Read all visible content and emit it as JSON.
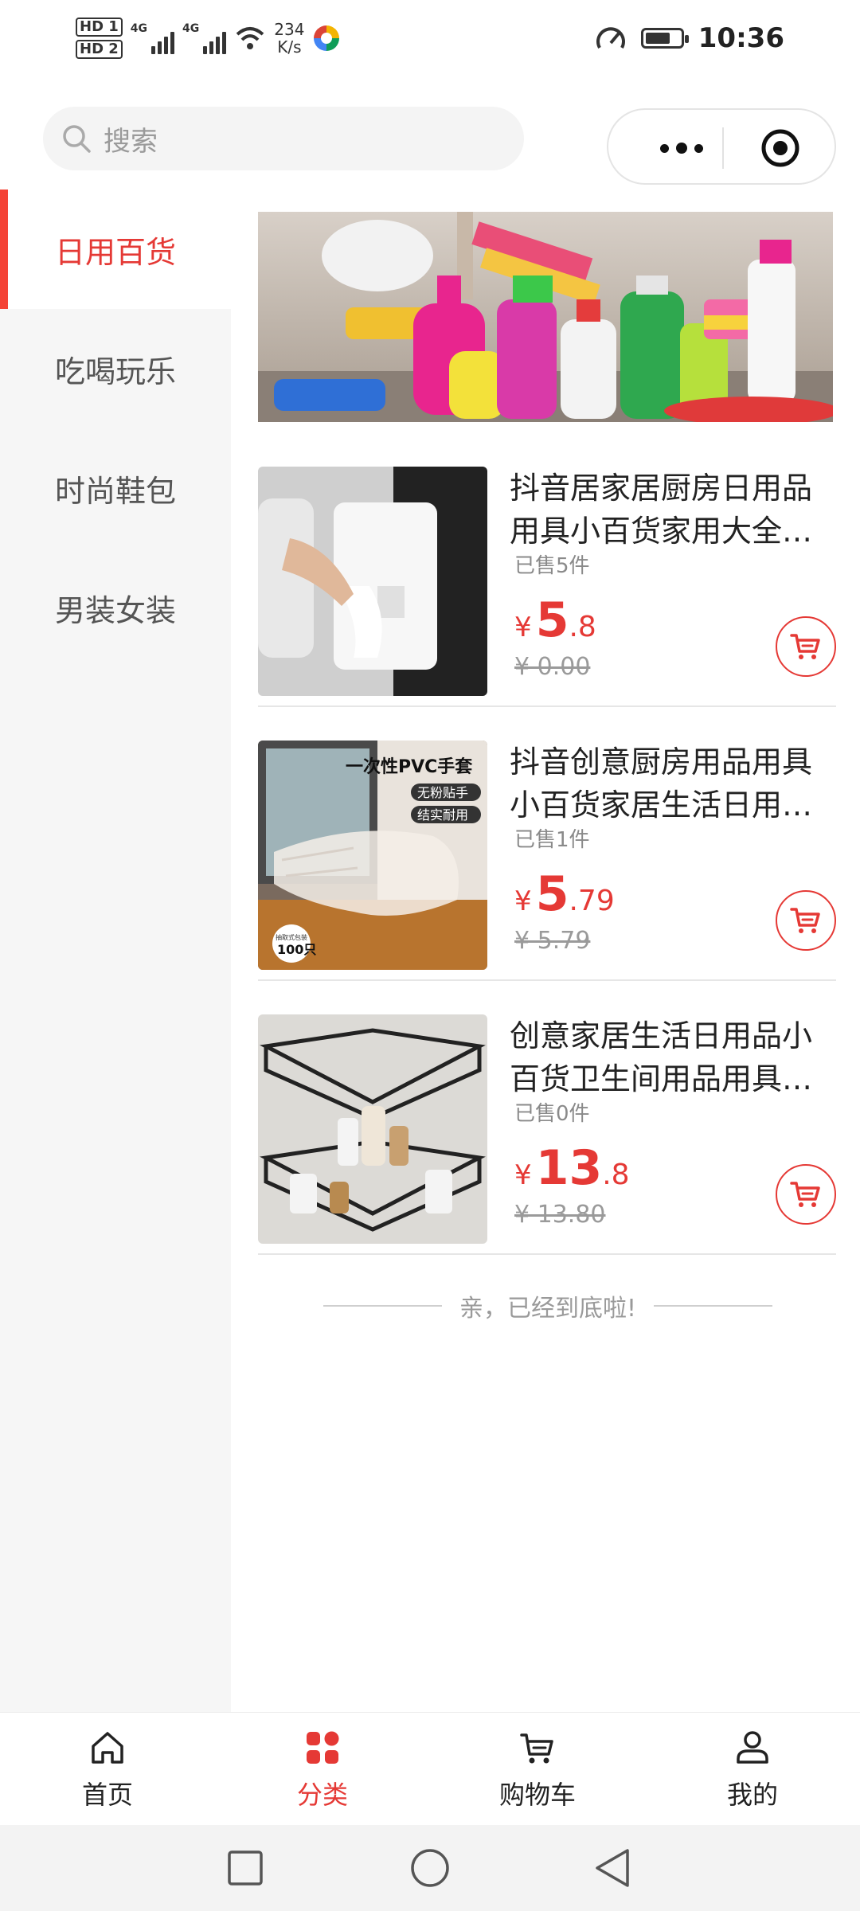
{
  "status_bar": {
    "hd1": "HD 1",
    "hd2": "HD 2",
    "net1": "4G",
    "net2": "4G",
    "speed_value": "234",
    "speed_unit": "K/s",
    "time": "10:36"
  },
  "header": {
    "search_placeholder": "搜索"
  },
  "sidebar": {
    "items": [
      {
        "label": "日用百货",
        "active": true
      },
      {
        "label": "吃喝玩乐",
        "active": false
      },
      {
        "label": "时尚鞋包",
        "active": false
      },
      {
        "label": "男装女装",
        "active": false
      }
    ]
  },
  "products": [
    {
      "title": "抖音居家居厨房日用品用具小百货家用大全…",
      "sold": "已售5件",
      "price_currency": "¥",
      "price_int": "5",
      "price_dec": ".8",
      "original_price": "¥ 0.00"
    },
    {
      "title": "抖音创意厨房用品用具小百货家居生活日用…",
      "sold": "已售1件",
      "price_currency": "¥",
      "price_int": "5",
      "price_dec": ".79",
      "original_price": "¥ 5.79",
      "image_text": {
        "headline": "一次性PVC手套",
        "tag1": "无粉贴手",
        "tag2": "结实耐用",
        "badge_small": "抽取式包装",
        "badge_big": "100只"
      }
    },
    {
      "title": "创意家居生活日用品小百货卫生间用品用具…",
      "sold": "已售0件",
      "price_currency": "¥",
      "price_int": "13",
      "price_dec": ".8",
      "original_price": "¥ 13.80"
    }
  ],
  "end_text": "亲，已经到底啦!",
  "tabbar": {
    "tabs": [
      {
        "label": "首页",
        "icon": "home-icon",
        "active": false
      },
      {
        "label": "分类",
        "icon": "category-icon",
        "active": true
      },
      {
        "label": "购物车",
        "icon": "cart-icon",
        "active": false
      },
      {
        "label": "我的",
        "icon": "user-icon",
        "active": false
      }
    ]
  },
  "colors": {
    "accent": "#e53935",
    "sidebar_bg": "#f6f6f6"
  }
}
